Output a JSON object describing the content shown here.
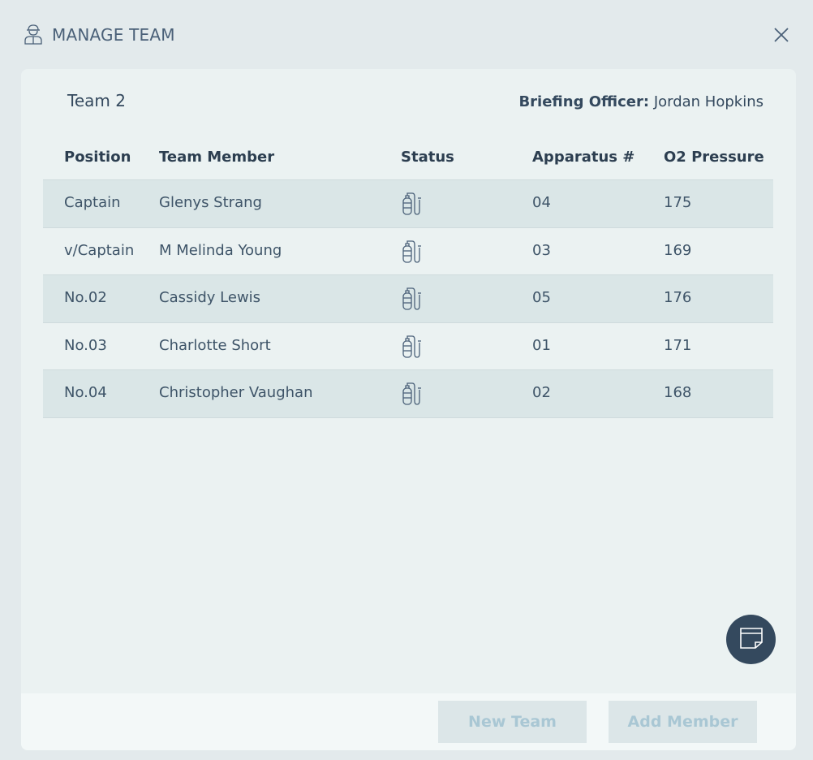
{
  "header": {
    "title": "MANAGE TEAM",
    "icon": "firefighter-user-icon",
    "close_icon": "close-icon"
  },
  "team": {
    "name": "Team 2",
    "officer_label": "Briefing Officer:",
    "officer_name": "Jordan Hopkins"
  },
  "table": {
    "columns": [
      "Position",
      "Team Member",
      "Status",
      "Apparatus #",
      "O2 Pressure"
    ],
    "rows": [
      {
        "position": "Captain",
        "member": "Glenys Strang",
        "status_icon": "breathing-apparatus-icon",
        "apparatus": "04",
        "pressure": "175"
      },
      {
        "position": "v/Captain",
        "member": "M Melinda Young",
        "status_icon": "breathing-apparatus-icon",
        "apparatus": "03",
        "pressure": "169"
      },
      {
        "position": "No.02",
        "member": "Cassidy Lewis",
        "status_icon": "breathing-apparatus-icon",
        "apparatus": "05",
        "pressure": "176"
      },
      {
        "position": "No.03",
        "member": "Charlotte Short",
        "status_icon": "breathing-apparatus-icon",
        "apparatus": "01",
        "pressure": "171"
      },
      {
        "position": "No.04",
        "member": "Christopher Vaughan",
        "status_icon": "breathing-apparatus-icon",
        "apparatus": "02",
        "pressure": "168"
      }
    ]
  },
  "notes_button": {
    "icon": "note-icon"
  },
  "footer": {
    "new_team_label": "New Team",
    "add_member_label": "Add Member"
  },
  "colors": {
    "accent": "#34495e",
    "background": "#e3eaec",
    "card": "#ebf2f2",
    "row_alt": "#dae6e7",
    "disabled_button_text": "#a9c7d4"
  }
}
